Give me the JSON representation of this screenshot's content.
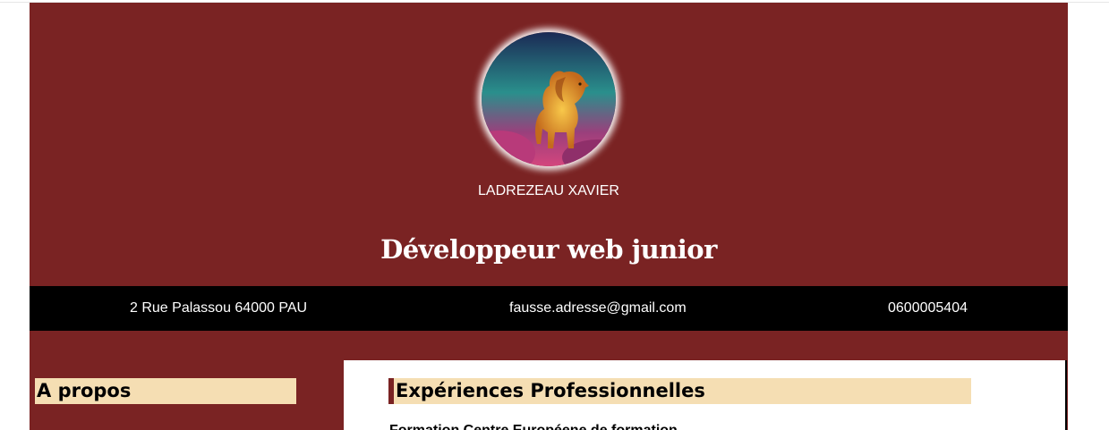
{
  "header": {
    "avatar_icon": "lion-portrait",
    "name": "LADREZEAU XAVIER",
    "job_title": "Développeur web junior"
  },
  "contact": {
    "address": "2 Rue Palassou 64000 PAU",
    "email": "fausse.adresse@gmail.com",
    "phone": "0600005404"
  },
  "sidebar": {
    "about_title": "A propos"
  },
  "main": {
    "experience_title": "Expériences Professionnelles",
    "first_entry_title": "Formation Centre Européene de formation"
  },
  "colors": {
    "background": "#7a2323",
    "contact_bar": "#000000",
    "heading_bg": "#f5deb3",
    "text_light": "#ffffff"
  }
}
